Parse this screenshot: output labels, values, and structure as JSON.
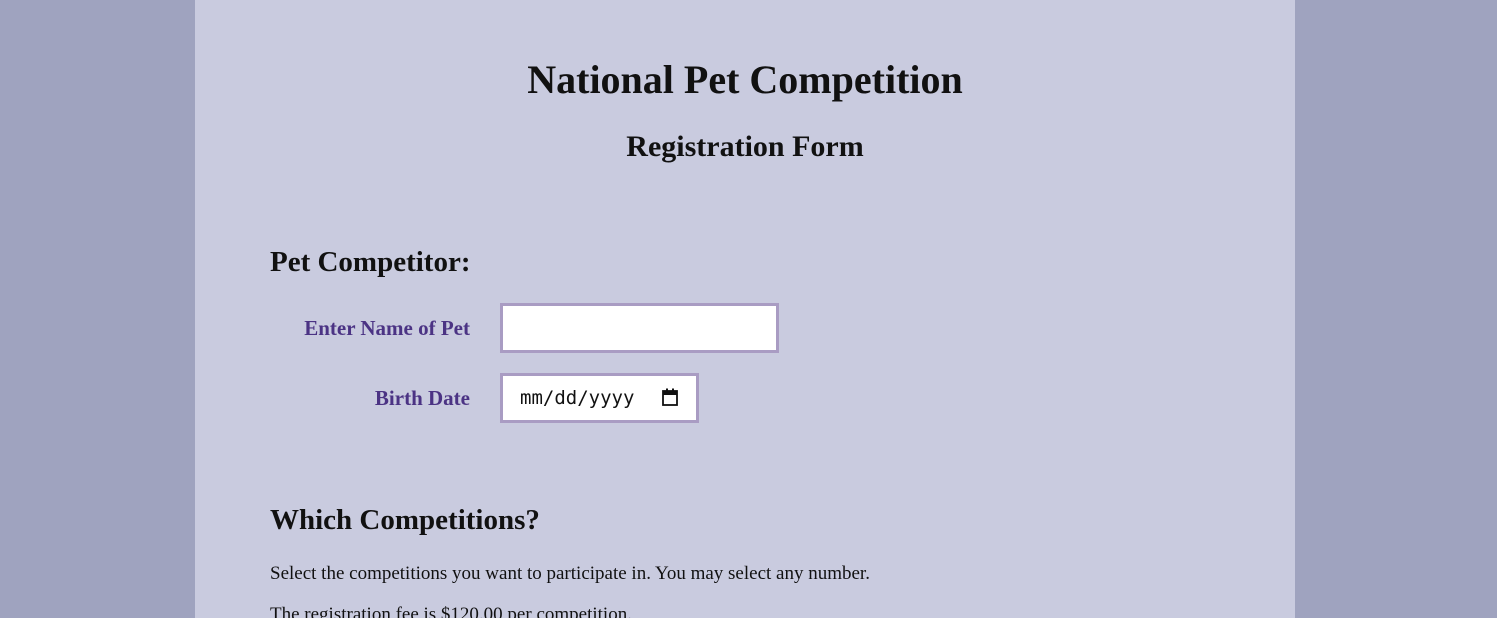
{
  "header": {
    "title": "National Pet Competition",
    "subtitle": "Registration Form"
  },
  "pet_section": {
    "heading": "Pet Competitor:",
    "name_label": "Enter Name of Pet",
    "name_value": "",
    "birth_label": "Birth Date",
    "birth_placeholder": "mm/dd/yyyy"
  },
  "competitions_section": {
    "heading": "Which Competitions?",
    "instructions": "Select the competitions you want to participate in. You may select any number.",
    "fee_text": "The registration fee is $120.00 per competition."
  },
  "colors": {
    "page_background": "#9fa3bf",
    "form_background": "#c9cbdf",
    "label_color": "#4b3384",
    "input_border": "#a99cc3"
  },
  "icons": {
    "date_picker": "calendar-icon"
  }
}
